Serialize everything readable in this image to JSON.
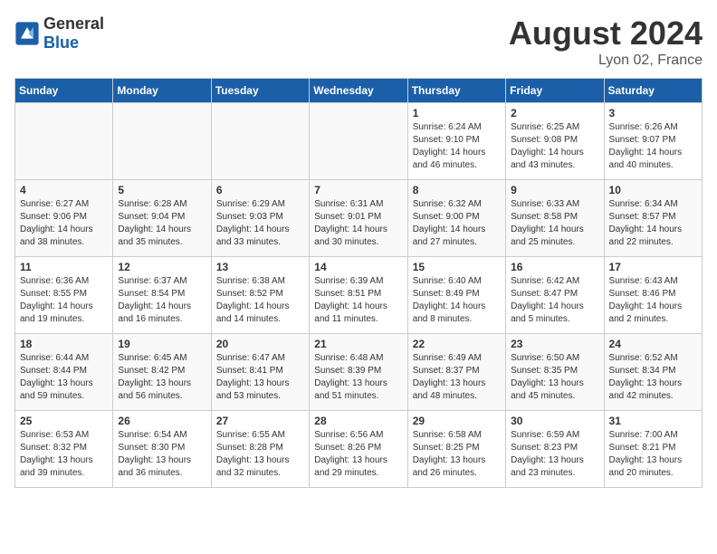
{
  "header": {
    "logo_general": "General",
    "logo_blue": "Blue",
    "title": "August 2024",
    "location": "Lyon 02, France"
  },
  "days_of_week": [
    "Sunday",
    "Monday",
    "Tuesday",
    "Wednesday",
    "Thursday",
    "Friday",
    "Saturday"
  ],
  "weeks": [
    [
      {
        "num": "",
        "info": "",
        "empty": true
      },
      {
        "num": "",
        "info": "",
        "empty": true
      },
      {
        "num": "",
        "info": "",
        "empty": true
      },
      {
        "num": "",
        "info": "",
        "empty": true
      },
      {
        "num": "1",
        "info": "Sunrise: 6:24 AM\nSunset: 9:10 PM\nDaylight: 14 hours\nand 46 minutes."
      },
      {
        "num": "2",
        "info": "Sunrise: 6:25 AM\nSunset: 9:08 PM\nDaylight: 14 hours\nand 43 minutes."
      },
      {
        "num": "3",
        "info": "Sunrise: 6:26 AM\nSunset: 9:07 PM\nDaylight: 14 hours\nand 40 minutes."
      }
    ],
    [
      {
        "num": "4",
        "info": "Sunrise: 6:27 AM\nSunset: 9:06 PM\nDaylight: 14 hours\nand 38 minutes."
      },
      {
        "num": "5",
        "info": "Sunrise: 6:28 AM\nSunset: 9:04 PM\nDaylight: 14 hours\nand 35 minutes."
      },
      {
        "num": "6",
        "info": "Sunrise: 6:29 AM\nSunset: 9:03 PM\nDaylight: 14 hours\nand 33 minutes."
      },
      {
        "num": "7",
        "info": "Sunrise: 6:31 AM\nSunset: 9:01 PM\nDaylight: 14 hours\nand 30 minutes."
      },
      {
        "num": "8",
        "info": "Sunrise: 6:32 AM\nSunset: 9:00 PM\nDaylight: 14 hours\nand 27 minutes."
      },
      {
        "num": "9",
        "info": "Sunrise: 6:33 AM\nSunset: 8:58 PM\nDaylight: 14 hours\nand 25 minutes."
      },
      {
        "num": "10",
        "info": "Sunrise: 6:34 AM\nSunset: 8:57 PM\nDaylight: 14 hours\nand 22 minutes."
      }
    ],
    [
      {
        "num": "11",
        "info": "Sunrise: 6:36 AM\nSunset: 8:55 PM\nDaylight: 14 hours\nand 19 minutes."
      },
      {
        "num": "12",
        "info": "Sunrise: 6:37 AM\nSunset: 8:54 PM\nDaylight: 14 hours\nand 16 minutes."
      },
      {
        "num": "13",
        "info": "Sunrise: 6:38 AM\nSunset: 8:52 PM\nDaylight: 14 hours\nand 14 minutes."
      },
      {
        "num": "14",
        "info": "Sunrise: 6:39 AM\nSunset: 8:51 PM\nDaylight: 14 hours\nand 11 minutes."
      },
      {
        "num": "15",
        "info": "Sunrise: 6:40 AM\nSunset: 8:49 PM\nDaylight: 14 hours\nand 8 minutes."
      },
      {
        "num": "16",
        "info": "Sunrise: 6:42 AM\nSunset: 8:47 PM\nDaylight: 14 hours\nand 5 minutes."
      },
      {
        "num": "17",
        "info": "Sunrise: 6:43 AM\nSunset: 8:46 PM\nDaylight: 14 hours\nand 2 minutes."
      }
    ],
    [
      {
        "num": "18",
        "info": "Sunrise: 6:44 AM\nSunset: 8:44 PM\nDaylight: 13 hours\nand 59 minutes."
      },
      {
        "num": "19",
        "info": "Sunrise: 6:45 AM\nSunset: 8:42 PM\nDaylight: 13 hours\nand 56 minutes."
      },
      {
        "num": "20",
        "info": "Sunrise: 6:47 AM\nSunset: 8:41 PM\nDaylight: 13 hours\nand 53 minutes."
      },
      {
        "num": "21",
        "info": "Sunrise: 6:48 AM\nSunset: 8:39 PM\nDaylight: 13 hours\nand 51 minutes."
      },
      {
        "num": "22",
        "info": "Sunrise: 6:49 AM\nSunset: 8:37 PM\nDaylight: 13 hours\nand 48 minutes."
      },
      {
        "num": "23",
        "info": "Sunrise: 6:50 AM\nSunset: 8:35 PM\nDaylight: 13 hours\nand 45 minutes."
      },
      {
        "num": "24",
        "info": "Sunrise: 6:52 AM\nSunset: 8:34 PM\nDaylight: 13 hours\nand 42 minutes."
      }
    ],
    [
      {
        "num": "25",
        "info": "Sunrise: 6:53 AM\nSunset: 8:32 PM\nDaylight: 13 hours\nand 39 minutes."
      },
      {
        "num": "26",
        "info": "Sunrise: 6:54 AM\nSunset: 8:30 PM\nDaylight: 13 hours\nand 36 minutes."
      },
      {
        "num": "27",
        "info": "Sunrise: 6:55 AM\nSunset: 8:28 PM\nDaylight: 13 hours\nand 32 minutes."
      },
      {
        "num": "28",
        "info": "Sunrise: 6:56 AM\nSunset: 8:26 PM\nDaylight: 13 hours\nand 29 minutes."
      },
      {
        "num": "29",
        "info": "Sunrise: 6:58 AM\nSunset: 8:25 PM\nDaylight: 13 hours\nand 26 minutes."
      },
      {
        "num": "30",
        "info": "Sunrise: 6:59 AM\nSunset: 8:23 PM\nDaylight: 13 hours\nand 23 minutes."
      },
      {
        "num": "31",
        "info": "Sunrise: 7:00 AM\nSunset: 8:21 PM\nDaylight: 13 hours\nand 20 minutes."
      }
    ]
  ]
}
